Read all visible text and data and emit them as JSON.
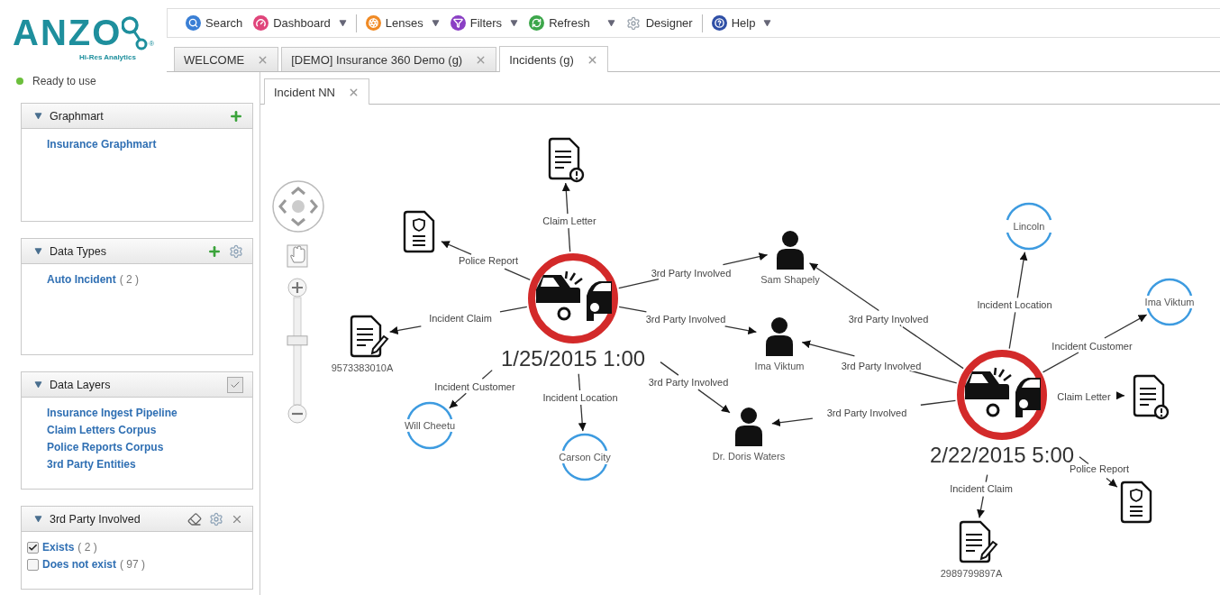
{
  "logo": {
    "wordmark": "ANZO",
    "tagline": "Hi-Res Analytics",
    "mark": "®"
  },
  "toolbar": {
    "groups": [
      [
        {
          "kind": "search",
          "label": "Search",
          "dropdown": false
        },
        {
          "kind": "dashboard",
          "label": "Dashboard",
          "dropdown": true
        }
      ],
      [
        {
          "kind": "lenses",
          "label": "Lenses",
          "dropdown": true
        },
        {
          "kind": "filters",
          "label": "Filters",
          "dropdown": true
        },
        {
          "kind": "refresh",
          "label": "Refresh",
          "dropdown": true
        },
        {
          "kind": "designer",
          "label": "Designer",
          "dropdown": false
        }
      ],
      [
        {
          "kind": "help",
          "label": "Help",
          "dropdown": true
        }
      ]
    ]
  },
  "tabs": [
    {
      "label": "WELCOME",
      "selected": false
    },
    {
      "label": "[DEMO] Insurance 360 Demo (g)",
      "selected": false
    },
    {
      "label": "Incidents (g)",
      "selected": true
    }
  ],
  "status": {
    "text": "Ready to use"
  },
  "sidebar": {
    "panels": [
      {
        "title": "Graphmart",
        "items": [
          {
            "kind": "link",
            "label": "Insurance Graphmart"
          }
        ]
      },
      {
        "title": "Data Types",
        "items": [
          {
            "kind": "link",
            "label": "Auto Incident",
            "count": "( 2 )"
          }
        ]
      },
      {
        "title": "Data Layers",
        "items": [
          {
            "kind": "link",
            "label": "Insurance Ingest Pipeline"
          },
          {
            "kind": "link",
            "label": "Claim Letters Corpus"
          },
          {
            "kind": "link",
            "label": "Police Reports Corpus"
          },
          {
            "kind": "link",
            "label": "3rd Party Entities"
          }
        ]
      },
      {
        "title": "3rd Party Involved",
        "items": [
          {
            "kind": "check",
            "label": "Exists",
            "count": "( 2 )",
            "checked": true
          },
          {
            "kind": "check",
            "label": "Does not exist",
            "count": "( 97 )",
            "checked": false
          }
        ]
      }
    ]
  },
  "view_tabs": [
    {
      "label": "Incident NN",
      "selected": true
    }
  ],
  "zoom": {
    "level": 0.58
  },
  "graph": {
    "nodes": [
      {
        "kind": "incident",
        "label": "1/25/2015 1:00"
      },
      {
        "kind": "incident",
        "label": "2/22/2015 5:00"
      },
      {
        "kind": "claim-letter"
      },
      {
        "kind": "police-report"
      },
      {
        "kind": "claim",
        "label": "9573383010A"
      },
      {
        "kind": "place",
        "label": "Will Cheetu"
      },
      {
        "kind": "place",
        "label": "Carson City"
      },
      {
        "kind": "person",
        "label": "Sam Shapely"
      },
      {
        "kind": "person",
        "label": "Ima Viktum"
      },
      {
        "kind": "person",
        "label": "Dr. Doris Waters"
      },
      {
        "kind": "place",
        "label": "Lincoln"
      },
      {
        "kind": "place",
        "label": "Ima Viktum"
      },
      {
        "kind": "claim-letter"
      },
      {
        "kind": "police-report"
      },
      {
        "kind": "claim",
        "label": "2989799897A"
      }
    ],
    "edges": [
      {
        "label": "Claim Letter"
      },
      {
        "label": "Police Report"
      },
      {
        "label": "3rd Party Involved"
      },
      {
        "label": "Incident Claim"
      },
      {
        "label": "3rd Party Involved"
      },
      {
        "label": "Incident Customer"
      },
      {
        "label": "Incident Location"
      },
      {
        "label": "3rd Party Involved"
      },
      {
        "label": "3rd Party Involved"
      },
      {
        "label": "3rd Party Involved"
      },
      {
        "label": "3rd Party Involved"
      },
      {
        "label": "Incident Location"
      },
      {
        "label": "Incident Customer"
      },
      {
        "label": "Claim Letter"
      },
      {
        "label": "Incident Claim"
      },
      {
        "label": "Police Report"
      }
    ]
  }
}
